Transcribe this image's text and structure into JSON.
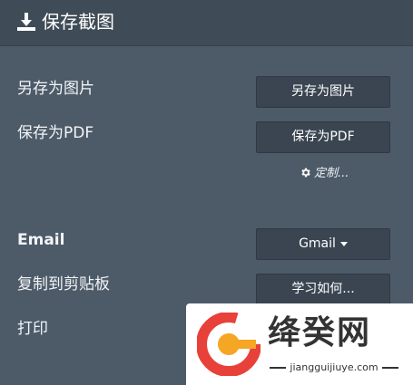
{
  "header": {
    "title": "保存截图",
    "icon": "download-icon"
  },
  "rows": [
    {
      "label": "另存为图片",
      "button": "另存为图片"
    },
    {
      "label": "保存为PDF",
      "button": "保存为PDF"
    },
    {
      "label": "Email",
      "button": "Gmail"
    },
    {
      "label": "复制到剪贴板",
      "button": "学习如何..."
    },
    {
      "label": "打印"
    }
  ],
  "customize": {
    "label": "定制...",
    "icon": "gear-icon"
  },
  "watermark": {
    "text_cn": "绛癸网",
    "url": "jiangguijiuye.com"
  }
}
